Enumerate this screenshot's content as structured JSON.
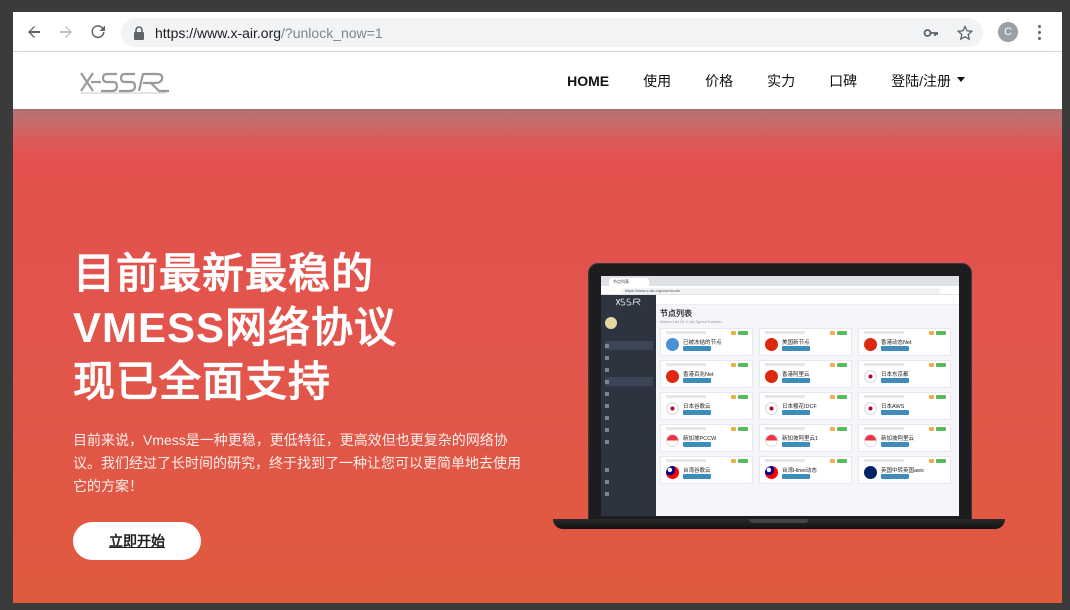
{
  "browser": {
    "url_host": "https://www.x-air.org",
    "url_rest": "/?unlock_now=1",
    "profile_initial": "C"
  },
  "site": {
    "logo_text": "X-SSR",
    "nav": [
      {
        "label": "HOME"
      },
      {
        "label": "使用"
      },
      {
        "label": "价格"
      },
      {
        "label": "实力"
      },
      {
        "label": "口碑"
      },
      {
        "label": "登陆/注册"
      }
    ]
  },
  "hero": {
    "title_lines": [
      "目前最新最稳的",
      "VMESS网络协议",
      "现已全面支持"
    ],
    "description": "目前来说，Vmess是一种更稳，更低特征，更高效但也更复杂的网络协议。我们经过了长时间的研究，终于找到了一种让您可以更简单地去使用它的方案！",
    "cta_label": "立即开始"
  },
  "mock_screen": {
    "tab_label": "节点列表",
    "url": "https://www.x-air.org/user/node",
    "heading": "节点列表",
    "subheading": "Nodes List Of X-Air Speed Booster",
    "nodes": [
      {
        "name": "已被冻结的节点",
        "flag": "un"
      },
      {
        "name": "美国新节点",
        "flag": "cn"
      },
      {
        "name": "香港动态Net",
        "flag": "hk"
      },
      {
        "name": "香港百兆Net",
        "flag": "hk"
      },
      {
        "name": "香港阿里云",
        "flag": "hk"
      },
      {
        "name": "日本东京都",
        "flag": "jp"
      },
      {
        "name": "日本谷歌云",
        "flag": "jp"
      },
      {
        "name": "日本樱花IDCF",
        "flag": "jp"
      },
      {
        "name": "日本AWS",
        "flag": "jp"
      },
      {
        "name": "新加坡PCCW",
        "flag": "sg"
      },
      {
        "name": "新加坡阿里云1",
        "flag": "sg"
      },
      {
        "name": "新加坡阿里云",
        "flag": "sg"
      },
      {
        "name": "台湾谷歌云",
        "flag": "tw"
      },
      {
        "name": "台湾Hinet动态",
        "flag": "tw"
      },
      {
        "name": "英国中转英国aws",
        "flag": "uk"
      }
    ]
  },
  "colors": {
    "hero_top": "#e4514e",
    "hero_bottom": "#e05a3e",
    "accent_blue": "#3c8dbc"
  }
}
